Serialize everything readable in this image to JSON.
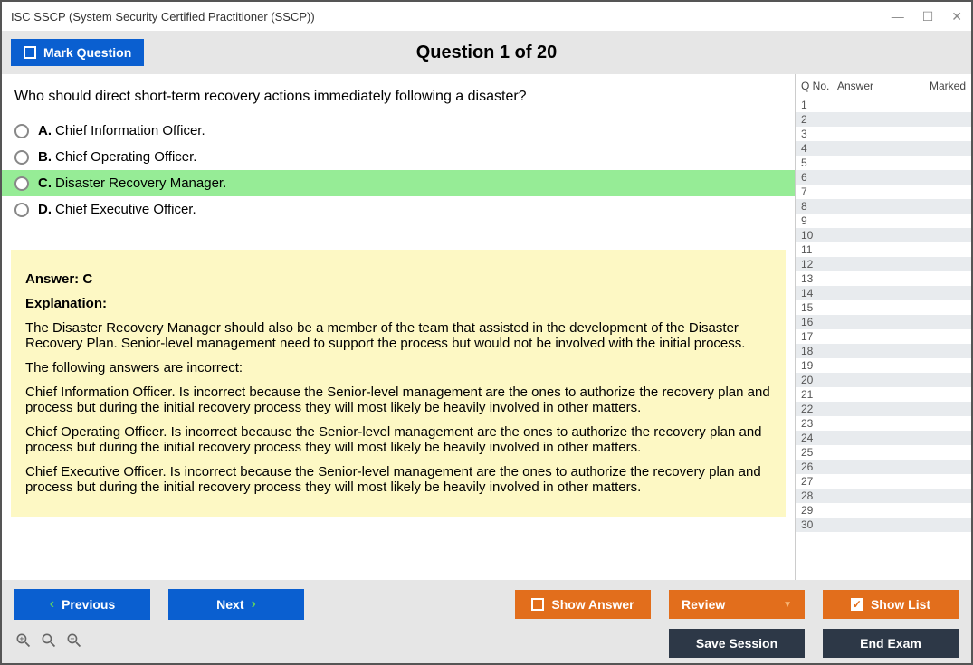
{
  "window_title": "ISC SSCP (System Security Certified Practitioner (SSCP))",
  "header": {
    "mark_label": "Mark Question",
    "question_title": "Question 1 of 20"
  },
  "question": {
    "text": "Who should direct short-term recovery actions immediately following a disaster?",
    "options": [
      {
        "letter": "A.",
        "text": "Chief Information Officer.",
        "selected": false,
        "highlight": false
      },
      {
        "letter": "B.",
        "text": "Chief Operating Officer.",
        "selected": false,
        "highlight": false
      },
      {
        "letter": "C.",
        "text": "Disaster Recovery Manager.",
        "selected": false,
        "highlight": true
      },
      {
        "letter": "D.",
        "text": "Chief Executive Officer.",
        "selected": false,
        "highlight": false
      }
    ]
  },
  "answer": {
    "heading": "Answer: C",
    "exp_label": "Explanation:",
    "paragraphs": [
      "The Disaster Recovery Manager should also be a member of the team that assisted in the development of the Disaster Recovery Plan. Senior-level management need to support the process but would not be involved with the initial process.",
      "The following answers are incorrect:",
      "Chief Information Officer. Is incorrect because the Senior-level management are the ones to authorize the recovery plan and process but during the initial recovery process they will most likely be heavily involved in other matters.",
      "Chief Operating Officer. Is incorrect because the Senior-level management are the ones to authorize the recovery plan and process but during the initial recovery process they will most likely be heavily involved in other matters.",
      "Chief Executive Officer. Is incorrect because the Senior-level management are the ones to authorize the recovery plan and process but during the initial recovery process they will most likely be heavily involved in other matters."
    ]
  },
  "sidebar": {
    "headers": {
      "c1": "Q No.",
      "c2": "Answer",
      "c3": "Marked"
    },
    "num_rows": 30
  },
  "footer": {
    "previous": "Previous",
    "next": "Next",
    "show_answer": "Show Answer",
    "review": "Review",
    "show_list": "Show List",
    "save_session": "Save Session",
    "end_exam": "End Exam"
  }
}
